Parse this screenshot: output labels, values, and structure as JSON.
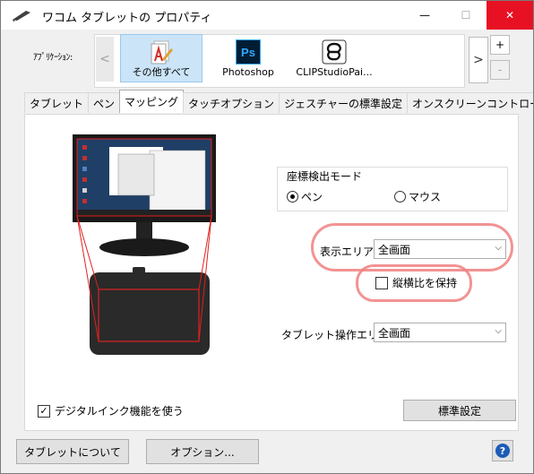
{
  "window": {
    "title": "ワコム タブレットの プロパティ",
    "minimize": "—",
    "maximize": "☐",
    "close": "✕"
  },
  "apps": {
    "label": "ｱﾌﾟﾘｹｰｼｮﾝ:",
    "items": [
      {
        "label": "その他すべて",
        "icon": "all-apps-icon",
        "selected": true
      },
      {
        "label": "Photoshop",
        "icon": "photoshop-icon",
        "selected": false
      },
      {
        "label": "CLIPStudioPai...",
        "icon": "clip-studio-icon",
        "selected": false
      }
    ],
    "scroll_left": "<",
    "scroll_right": ">",
    "add": "+",
    "remove": "-",
    "ps_text": "Ps"
  },
  "tabs": [
    {
      "label": "タブレット",
      "active": false
    },
    {
      "label": "ペン",
      "active": false
    },
    {
      "label": "マッピング",
      "active": true
    },
    {
      "label": "タッチオプション",
      "active": false
    },
    {
      "label": "ジェスチャーの標準設定",
      "active": false
    },
    {
      "label": "オンスクリーンコントロール",
      "active": false
    }
  ],
  "mapping": {
    "mode_group_title": "座標検出モード",
    "mode_pen": "ペン",
    "mode_mouse": "マウス",
    "mode_selected": "pen",
    "display_area_label": "表示エリア:",
    "display_area_value": "全画面",
    "keep_aspect_label": "縦横比を保持",
    "keep_aspect_checked": false,
    "tablet_area_label": "タブレット操作エリア:",
    "tablet_area_value": "全画面",
    "digital_ink_label": "デジタルインク機能を使う",
    "digital_ink_checked": true,
    "default_button": "標準設定"
  },
  "footer": {
    "about_button": "タブレットについて",
    "options_button": "オプション...",
    "help": "?"
  },
  "colors": {
    "selected_bg": "#cce4f7",
    "close_red": "#e81123",
    "annotation": "#f08080",
    "mapping_lines": "#e02020",
    "help_blue": "#1c5bb8"
  }
}
